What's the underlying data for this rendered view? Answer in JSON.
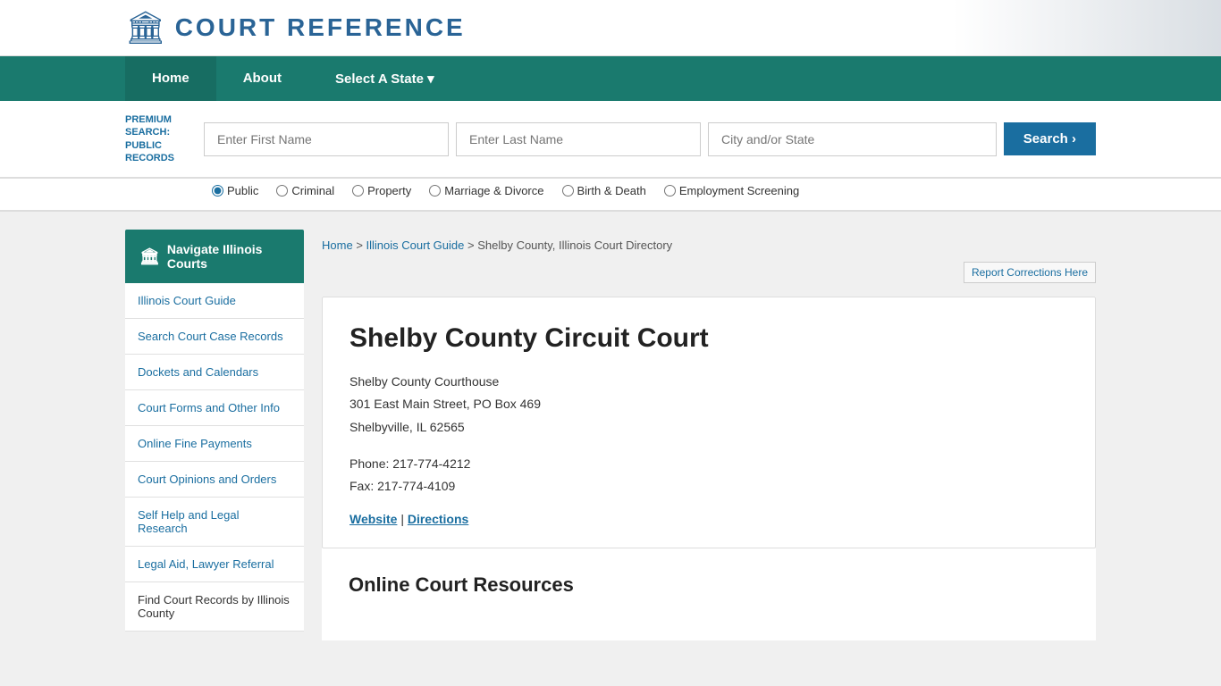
{
  "site": {
    "logo_icon": "🏛",
    "logo_text": "COURT REFERENCE"
  },
  "navbar": {
    "items": [
      {
        "label": "Home",
        "active": true
      },
      {
        "label": "About",
        "active": false
      },
      {
        "label": "Select A State ▾",
        "active": false
      }
    ]
  },
  "premium_search": {
    "label_line1": "PREMIUM",
    "label_line2": "SEARCH:",
    "label_line3": "PUBLIC",
    "label_line4": "RECORDS",
    "first_name_placeholder": "Enter First Name",
    "last_name_placeholder": "Enter Last Name",
    "city_placeholder": "City and/or State",
    "button_label": "Search  ›"
  },
  "radio_options": [
    {
      "label": "Public",
      "checked": true
    },
    {
      "label": "Criminal",
      "checked": false
    },
    {
      "label": "Property",
      "checked": false
    },
    {
      "label": "Marriage & Divorce",
      "checked": false
    },
    {
      "label": "Birth & Death",
      "checked": false
    },
    {
      "label": "Employment Screening",
      "checked": false
    }
  ],
  "breadcrumb": {
    "home": "Home",
    "guide": "Illinois Court Guide",
    "current": "Shelby County, Illinois Court Directory"
  },
  "report_corrections": {
    "label": "Report Corrections Here"
  },
  "sidebar": {
    "title": "Navigate Illinois Courts",
    "items": [
      {
        "label": "Illinois Court Guide"
      },
      {
        "label": "Search Court Case Records"
      },
      {
        "label": "Dockets and Calendars"
      },
      {
        "label": "Court Forms and Other Info"
      },
      {
        "label": "Online Fine Payments"
      },
      {
        "label": "Court Opinions and Orders"
      },
      {
        "label": "Self Help and Legal Research"
      },
      {
        "label": "Legal Aid, Lawyer Referral"
      },
      {
        "label": "Find Court Records by Illinois County"
      }
    ]
  },
  "court": {
    "name": "Shelby County Circuit Court",
    "address_line1": "Shelby County Courthouse",
    "address_line2": "301 East Main Street, PO Box 469",
    "address_line3": "Shelbyville, IL 62565",
    "phone": "Phone: 217-774-4212",
    "fax": "Fax: 217-774-4109",
    "website_label": "Website",
    "directions_label": "Directions"
  },
  "online_resources": {
    "heading": "Online Court Resources"
  }
}
